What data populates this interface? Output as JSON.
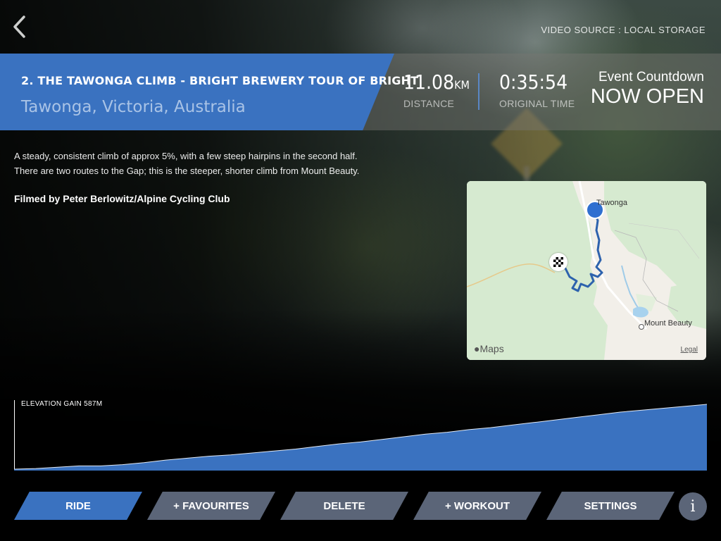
{
  "header": {
    "back_icon": "chevron-left-icon",
    "video_source": "VIDEO SOURCE : LOCAL STORAGE"
  },
  "route": {
    "title": "2. THE TAWONGA CLIMB - BRIGHT BREWERY TOUR OF BRIGHT",
    "location": "Tawonga, Victoria, Australia",
    "description": "A steady, consistent climb of approx 5%, with a few steep hairpins in the second half. There are two routes to the Gap; this is the steeper, shorter climb from Mount Beauty.",
    "credit": "Filmed by Peter Berlowitz/Alpine Cycling Club"
  },
  "stats": {
    "distance_value": "11.08",
    "distance_unit": "KM",
    "distance_label": "DISTANCE",
    "time_value": "0:35:54",
    "time_label": "ORIGINAL TIME"
  },
  "countdown": {
    "label": "Event Countdown",
    "status": "NOW OPEN"
  },
  "map": {
    "place_start": "Tawonga",
    "place_town": "Mount Beauty",
    "logo": "Maps",
    "legal": "Legal",
    "start_icon": "start-pin-icon",
    "finish_icon": "checkered-flag-icon"
  },
  "elevation": {
    "label": "ELEVATION GAIN 587M",
    "profile": [
      0.0,
      0.01,
      0.03,
      0.05,
      0.05,
      0.07,
      0.1,
      0.14,
      0.17,
      0.2,
      0.22,
      0.25,
      0.28,
      0.31,
      0.35,
      0.39,
      0.42,
      0.46,
      0.5,
      0.54,
      0.57,
      0.61,
      0.64,
      0.68,
      0.72,
      0.76,
      0.8,
      0.84,
      0.88,
      0.91,
      0.94,
      0.97,
      1.0
    ],
    "fill_color": "#3a72c0"
  },
  "buttons": {
    "ride": "RIDE",
    "favourites": "+ FAVOURITES",
    "delete": "DELETE",
    "workout": "+ WORKOUT",
    "settings": "SETTINGS",
    "info": "i"
  },
  "colors": {
    "accent": "#3a72c0",
    "button_secondary": "#5b6578"
  }
}
